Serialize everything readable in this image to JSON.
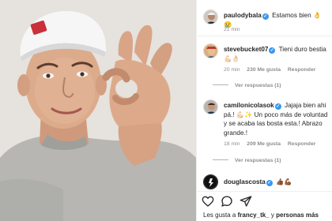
{
  "post": {
    "image_alt": "",
    "photo_colors": {
      "background": "#e6e2dd",
      "cap": "#ffffff",
      "shirt": "#b9b9b6",
      "skin": "#d9a98a"
    }
  },
  "comments": [
    {
      "username": "paulodybala",
      "verified": true,
      "text": "Estamos bien",
      "emoji": "👌😢",
      "time": "21 min",
      "likes": "",
      "reply": "",
      "view_replies": ""
    },
    {
      "username": "stevebucket07",
      "verified": true,
      "text": "Tieni duro bestia",
      "emoji": "💪🏻👌🏻",
      "time": "20 min",
      "likes": "230 Me gusta",
      "reply": "Responder",
      "view_replies": "Ver respuestas (1)"
    },
    {
      "username": "camilonicolasok",
      "verified": true,
      "text": "Jajaja bien ahi pá.! 💪🏻✨ Un poco más de voluntad y se acaba las bosta esta.! Abrazo grande.!",
      "emoji": "",
      "time": "18 min",
      "likes": "209 Me gusta",
      "reply": "Responder",
      "view_replies": "Ver respuestas (1)"
    },
    {
      "username": "douglascosta",
      "verified": true,
      "text": "",
      "emoji": "👍🏾💪🏾",
      "time": "",
      "likes": "",
      "reply": "",
      "view_replies": ""
    }
  ],
  "actions": {
    "like_icon": "heart-icon",
    "comment_icon": "comment-bubble-icon",
    "share_icon": "paper-plane-icon"
  },
  "liked_by": {
    "prefix": "Les gusta a",
    "user": "francy_tk_",
    "conj": "y",
    "others": "personas más"
  }
}
